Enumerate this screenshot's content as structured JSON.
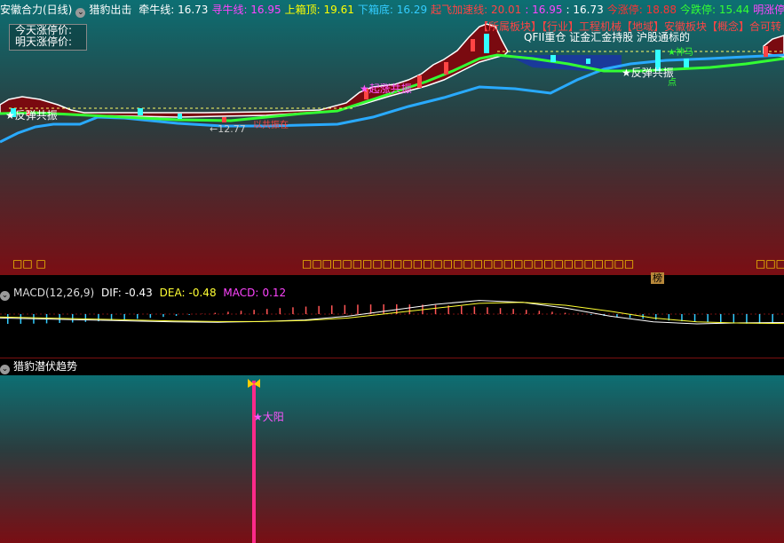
{
  "header": {
    "stock": "安徽合力(日线)",
    "indicator": "猎豹出击",
    "items": [
      {
        "label": "牵牛线:",
        "value": "16.73",
        "color": "#ffffff"
      },
      {
        "label": "寻牛线:",
        "value": "16.95",
        "color": "#ff44ff"
      },
      {
        "label": "上箱顶:",
        "value": "19.61",
        "color": "#ffff00"
      },
      {
        "label": "下箱底:",
        "value": "16.29",
        "color": "#33ccff"
      },
      {
        "label": "起飞加速线:",
        "value": "20.01",
        "color": "#ff4444"
      },
      {
        "label": ":",
        "value": "16.95",
        "color": "#ff44ff"
      },
      {
        "label": ":",
        "value": "16.73",
        "color": "#ffffff"
      },
      {
        "label": "今涨停:",
        "value": "18.88",
        "color": "#ff3333"
      },
      {
        "label": "今跌停:",
        "value": "15.44",
        "color": "#33ff33"
      },
      {
        "label": "明涨停:",
        "value": "19.09",
        "color": "#ff44ff"
      }
    ]
  },
  "limit_box": {
    "line1": "今天涨停价:",
    "line2": "明天涨停价:"
  },
  "main_chart": {
    "concept_text": "【所属板块】【行业】工程机械【地域】安徽板块【概念】合可转",
    "concept_text2": "QFII重仓 证金汇金持股 沪股通标的",
    "signal_left": "★反弹共振",
    "signal_right": "★反弹共振",
    "signal_mid": "★起涨共振",
    "label_low": "←12.77",
    "label_low2": "以共振在",
    "label_green": "★神马",
    "label_green2": "点",
    "bottom_yellow_left": "□□  □",
    "bottom_yellow_mid": "□□□□□□□□□□□□□□□□□□□□□□□□□□□□□□□□□",
    "bottom_yellow_right": "□□□"
  },
  "divider_tag": "榜",
  "macd": {
    "title": "MACD(12,26,9)",
    "dif_label": "DIF:",
    "dif": "-0.43",
    "dea_label": "DEA:",
    "dea": "-0.48",
    "macd_label": "MACD:",
    "macd": "0.12"
  },
  "trend": {
    "title": "猎豹潜伏趋势",
    "signal": "★大阳"
  },
  "chart_data": {
    "type": "line",
    "series": [
      {
        "name": "MACD DIF",
        "values": [
          -0.2,
          -0.25,
          -0.3,
          -0.35,
          -0.4,
          -0.42,
          -0.38,
          -0.3,
          -0.1,
          0.2,
          0.5,
          0.7,
          0.6,
          0.3,
          -0.1,
          -0.4,
          -0.5,
          -0.45,
          -0.43
        ]
      },
      {
        "name": "MACD DEA",
        "values": [
          -0.15,
          -0.2,
          -0.25,
          -0.3,
          -0.35,
          -0.38,
          -0.38,
          -0.33,
          -0.2,
          0.05,
          0.3,
          0.55,
          0.6,
          0.45,
          0.15,
          -0.2,
          -0.4,
          -0.46,
          -0.48
        ]
      }
    ],
    "ylim": [
      -1,
      1
    ]
  }
}
